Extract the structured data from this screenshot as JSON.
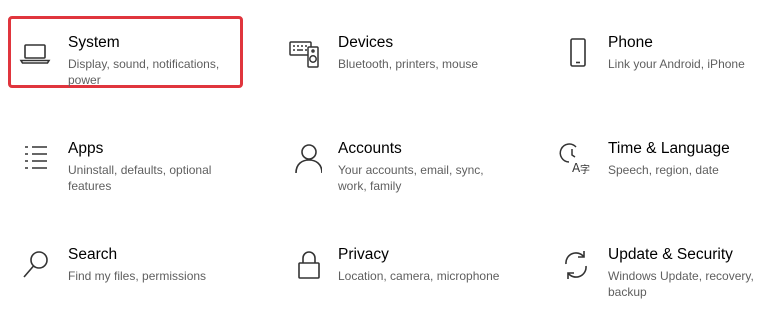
{
  "settings_tiles": [
    {
      "title": "System",
      "description": "Display, sound, notifications, power",
      "icon": "laptop-icon",
      "highlighted": true
    },
    {
      "title": "Devices",
      "description": "Bluetooth, printers, mouse",
      "icon": "keyboard-speaker-icon"
    },
    {
      "title": "Phone",
      "description": "Link your Android, iPhone",
      "icon": "phone-icon"
    },
    {
      "title": "Apps",
      "description": "Uninstall, defaults, optional features",
      "icon": "apps-list-icon"
    },
    {
      "title": "Accounts",
      "description": "Your accounts, email, sync, work, family",
      "icon": "person-icon"
    },
    {
      "title": "Time & Language",
      "description": "Speech, region, date",
      "icon": "clock-language-icon"
    },
    {
      "title": "Search",
      "description": "Find my files, permissions",
      "icon": "search-icon"
    },
    {
      "title": "Privacy",
      "description": "Location, camera, microphone",
      "icon": "lock-icon"
    },
    {
      "title": "Update & Security",
      "description": "Windows Update, recovery, backup",
      "icon": "sync-icon"
    }
  ],
  "highlight_color": "#e0353d",
  "icon_color": "#333333",
  "description_color": "#5f5f5f"
}
